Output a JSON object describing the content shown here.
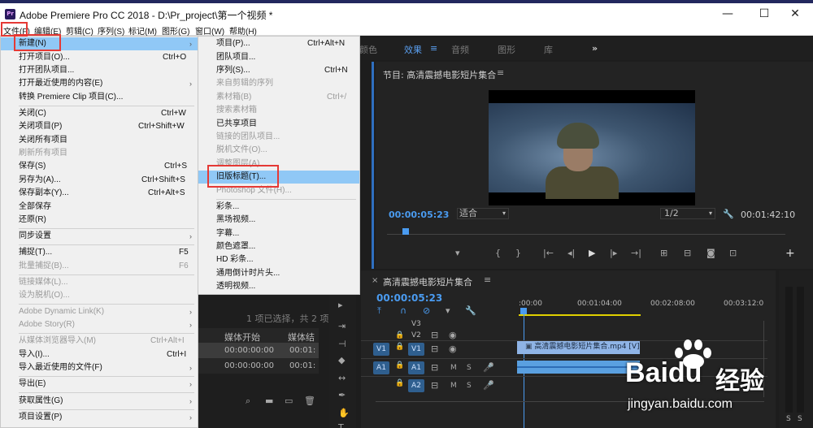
{
  "window": {
    "title": "Adobe Premiere Pro CC 2018 - D:\\Pr_project\\第一个视频 *",
    "app_icon": "Pr",
    "controls": {
      "minimize": "—",
      "maximize": "☐",
      "close": "✕"
    }
  },
  "menubar": {
    "items": [
      "文件(F)",
      "编辑(E)",
      "剪辑(C)",
      "序列(S)",
      "标记(M)",
      "图形(G)",
      "窗口(W)",
      "帮助(H)"
    ]
  },
  "file_menu": {
    "items": [
      {
        "label": "新建(N)",
        "shortcut": "",
        "arrow": "›"
      },
      {
        "label": "打开项目(O)...",
        "shortcut": "Ctrl+O"
      },
      {
        "label": "打开团队项目...",
        "shortcut": ""
      },
      {
        "label": "打开最近使用的内容(E)",
        "shortcut": "",
        "arrow": "›"
      },
      {
        "label": "转换 Premiere Clip 项目(C)...",
        "shortcut": ""
      },
      {
        "label": "关闭(C)",
        "shortcut": "Ctrl+W"
      },
      {
        "label": "关闭项目(P)",
        "shortcut": "Ctrl+Shift+W"
      },
      {
        "label": "关闭所有项目",
        "shortcut": ""
      },
      {
        "label": "刷新所有项目",
        "shortcut": "",
        "disabled": true
      },
      {
        "label": "保存(S)",
        "shortcut": "Ctrl+S"
      },
      {
        "label": "另存为(A)...",
        "shortcut": "Ctrl+Shift+S"
      },
      {
        "label": "保存副本(Y)...",
        "shortcut": "Ctrl+Alt+S"
      },
      {
        "label": "全部保存",
        "shortcut": ""
      },
      {
        "label": "还原(R)",
        "shortcut": ""
      },
      {
        "label": "同步设置",
        "shortcut": "",
        "arrow": "›"
      },
      {
        "label": "捕捉(T)...",
        "shortcut": "F5"
      },
      {
        "label": "批量捕捉(B)...",
        "shortcut": "F6",
        "disabled": true
      },
      {
        "label": "链接媒体(L)...",
        "shortcut": "",
        "disabled": true
      },
      {
        "label": "设为脱机(O)...",
        "shortcut": "",
        "disabled": true
      },
      {
        "label": "Adobe Dynamic Link(K)",
        "shortcut": "",
        "arrow": "›",
        "disabled": true
      },
      {
        "label": "Adobe Story(R)",
        "shortcut": "",
        "arrow": "›",
        "disabled": true
      },
      {
        "label": "从媒体浏览器导入(M)",
        "shortcut": "Ctrl+Alt+I",
        "disabled": true
      },
      {
        "label": "导入(I)...",
        "shortcut": "Ctrl+I"
      },
      {
        "label": "导入最近使用的文件(F)",
        "shortcut": "",
        "arrow": "›"
      },
      {
        "label": "导出(E)",
        "shortcut": "",
        "arrow": "›"
      },
      {
        "label": "获取属性(G)",
        "shortcut": "",
        "arrow": "›"
      },
      {
        "label": "项目设置(P)",
        "shortcut": "",
        "arrow": "›"
      }
    ]
  },
  "new_submenu": {
    "items": [
      {
        "label": "项目(P)...",
        "shortcut": "Ctrl+Alt+N"
      },
      {
        "label": "团队项目...",
        "shortcut": ""
      },
      {
        "label": "序列(S)...",
        "shortcut": "Ctrl+N"
      },
      {
        "label": "来自剪辑的序列",
        "shortcut": "",
        "disabled": true
      },
      {
        "label": "素材箱(B)",
        "shortcut": "Ctrl+/",
        "disabled": true
      },
      {
        "label": "搜索素材箱",
        "shortcut": "",
        "disabled": true
      },
      {
        "label": "已共享项目",
        "shortcut": ""
      },
      {
        "label": "链接的团队项目...",
        "shortcut": "",
        "disabled": true
      },
      {
        "label": "脱机文件(O)...",
        "shortcut": "",
        "disabled": true
      },
      {
        "label": "调整图层(A)...",
        "shortcut": "",
        "disabled": true
      },
      {
        "label": "旧版标题(T)...",
        "shortcut": ""
      },
      {
        "label": "Photoshop 文件(H)...",
        "shortcut": "",
        "disabled": true
      },
      {
        "label": "彩条...",
        "shortcut": ""
      },
      {
        "label": "黑场视频...",
        "shortcut": ""
      },
      {
        "label": "字幕...",
        "shortcut": ""
      },
      {
        "label": "颜色遮罩...",
        "shortcut": ""
      },
      {
        "label": "HD 彩条...",
        "shortcut": ""
      },
      {
        "label": "通用倒计时片头...",
        "shortcut": ""
      },
      {
        "label": "透明视频...",
        "shortcut": ""
      }
    ]
  },
  "workspace_tabs": {
    "partial": "颜色",
    "effects": "效果",
    "audio": "音频",
    "graphics": "图形",
    "library": "库",
    "more": "»"
  },
  "program_monitor": {
    "title": "节目: 高清震撼电影短片集合",
    "timecode": "00:00:05:23",
    "fit": "适合",
    "resolution": "1/2",
    "duration": "00:01:42:10"
  },
  "project_panel": {
    "selection_info": "1 项已选择，共 2 项",
    "col_media_start": "媒体开始",
    "col_media_end": "媒体结",
    "rows": [
      {
        "start": "00:00:00:00",
        "end": "00:01:"
      },
      {
        "start": "00:00:00:00",
        "end": "00:01:"
      }
    ]
  },
  "timeline": {
    "title": "高清震撼电影短片集合",
    "timecode": "00:00:05:23",
    "ruler": [
      ":00:00",
      "00:01:04:00",
      "00:02:08:00",
      "00:03:12:0"
    ],
    "tracks": [
      {
        "name": "V3"
      },
      {
        "name": "V2"
      },
      {
        "src": "V1",
        "name": "V1"
      },
      {
        "src": "A1",
        "name": "A1"
      },
      {
        "name": "A2"
      }
    ],
    "m_label": "M",
    "s_label": "S",
    "video_clip": "高清震撼电影短片集合.mp4 [V]",
    "audio_meter_labels": [
      "S",
      "S"
    ]
  },
  "watermark": {
    "brand": "Baidu",
    "brand_suffix": "经验",
    "url": "jingyan.baidu.com"
  }
}
